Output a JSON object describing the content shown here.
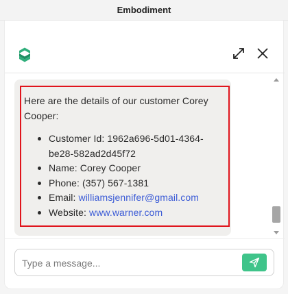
{
  "window": {
    "title": "Embodiment"
  },
  "header": {
    "logo_icon": "embodiment-logo-icon",
    "expand_icon": "expand-arrows-icon",
    "close_icon": "close-icon"
  },
  "message": {
    "intro": "Here are the details of our customer Corey Cooper:",
    "items": [
      {
        "label": "Customer Id: ",
        "value": "1962a696-5d01-4364-be28-582ad2d45f72"
      },
      {
        "label": "Name: ",
        "value": "Corey Cooper"
      },
      {
        "label": "Phone: ",
        "value": "(357) 567-1381"
      },
      {
        "label": "Email: ",
        "value": "williamsjennifer@gmail.com"
      },
      {
        "label": "Website: ",
        "value": "www.warner.com"
      }
    ]
  },
  "composer": {
    "placeholder": "Type a message...",
    "send_icon": "send-icon"
  },
  "colors": {
    "accent": "#3fc48a",
    "link": "#3b5bd6",
    "highlight": "#e0141c",
    "bubble": "#f0efed"
  }
}
